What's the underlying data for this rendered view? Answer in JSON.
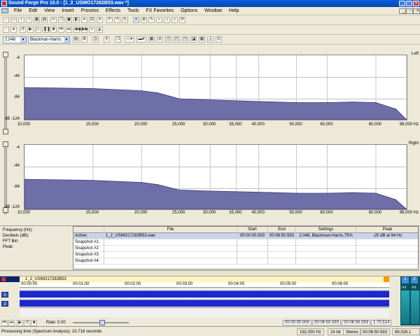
{
  "window": {
    "title": "Sound Forge Pro 10.0 - [1_2_USMO17282B53.wav *]"
  },
  "menu": [
    "File",
    "Edit",
    "View",
    "Insert",
    "Process",
    "Effects",
    "Tools",
    "FX Favorites",
    "Options",
    "Window",
    "Help"
  ],
  "spectrum_toolbar": {
    "fft_size": "2,048",
    "window_type": "Blackman-Harris"
  },
  "chart_data": [
    {
      "type": "area",
      "channel": "Left",
      "ylabel": "dB",
      "y_ticks": [
        -4,
        -44,
        -84,
        -124
      ],
      "ylim": [
        -124,
        -4
      ],
      "x_ticks": [
        "10,000",
        "15,000",
        "20,000",
        "25,000",
        "30,000",
        "35,000",
        "40,000",
        "50,000",
        "60,000",
        "80,000",
        "96,000"
      ],
      "xunit": "Hz",
      "x": [
        10000,
        15000,
        20000,
        22000,
        25000,
        30000,
        40000,
        50000,
        60000,
        70000,
        80000,
        90000,
        96000
      ],
      "y": [
        -64,
        -66,
        -70,
        -74,
        -85,
        -87,
        -90,
        -92,
        -92,
        -91,
        -92,
        -104,
        -124
      ]
    },
    {
      "type": "area",
      "channel": "Right",
      "ylabel": "dB",
      "y_ticks": [
        -4,
        -44,
        -84,
        -124
      ],
      "ylim": [
        -124,
        -4
      ],
      "x_ticks": [
        "10,000",
        "15,000",
        "20,000",
        "25,000",
        "30,000",
        "35,000",
        "40,000",
        "50,000",
        "60,000",
        "80,000",
        "96,000"
      ],
      "xunit": "Hz",
      "x": [
        10000,
        15000,
        20000,
        22000,
        25000,
        30000,
        40000,
        50000,
        60000,
        70000,
        80000,
        90000,
        96000
      ],
      "y": [
        -68,
        -70,
        -74,
        -78,
        -88,
        -90,
        -92,
        -94,
        -94,
        -93,
        -94,
        -106,
        -124
      ]
    }
  ],
  "info": {
    "labels": [
      "Frequency (Hz):",
      "Decibels (dB):",
      "FFT Bin:",
      "Peak:"
    ],
    "columns": [
      "",
      "File",
      "Start",
      "End",
      "Settings",
      "Peak"
    ],
    "rows": [
      [
        "Active:",
        "1_2_USMO17282B53.wav",
        "00:00:00.000",
        "00:06:50.593",
        "2,048, Blackman-Harris,75%",
        "-25 dB at 94 Hz"
      ],
      [
        "Snapshot #1:",
        "",
        "",
        "",
        "",
        ""
      ],
      [
        "Snapshot #2:",
        "",
        "",
        "",
        "",
        ""
      ],
      [
        "Snapshot #3:",
        "",
        "",
        "",
        "",
        ""
      ],
      [
        "Snapshot #4:",
        "",
        "",
        "",
        "",
        ""
      ]
    ]
  },
  "data_window": {
    "filename": "1_2_USMO17282B53",
    "time_ruler": [
      "00:00:00",
      "00:01:00",
      "00:02:00",
      "00:03:00",
      "00:04:00",
      "00:05:00",
      "00:06:00"
    ],
    "channels": [
      "1",
      "2"
    ],
    "rate_label": "Rate: 0.00",
    "position": "00:00:00.000",
    "end": "00:06:50.593",
    "length": "00:06:50.593",
    "zoom": "1:70,514",
    "meter_labels": [
      "-Inf.",
      "-Inf."
    ]
  },
  "status": {
    "message": "Processing time (Spectrum Analysis): 10.718 seconds",
    "sample_rate": "192,000 Hz",
    "bit_depth": "24 bit",
    "channels": "Stereo",
    "duration": "00:06:50.593",
    "free_space": "89,026.1 MB"
  },
  "colors": {
    "spectrum_fill": "#6e6ea8",
    "spectrum_stroke": "#3c3c78",
    "wave": "#1520c8",
    "titlebar": "#0a5fd8"
  }
}
